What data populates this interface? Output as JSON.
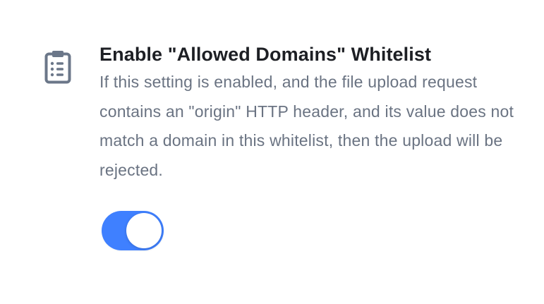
{
  "setting": {
    "icon": "clipboard-list-icon",
    "title": "Enable \"Allowed Domains\" Whitelist",
    "description": "If this setting is enabled, and the file upload request contains an \"origin\" HTTP header, and its value does not match a domain in this whitelist, then the upload will be rejected.",
    "enabled": true
  },
  "colors": {
    "accent": "#3f80ff",
    "title": "#1d1f24",
    "description": "#6a7382",
    "icon": "#6b7789"
  }
}
